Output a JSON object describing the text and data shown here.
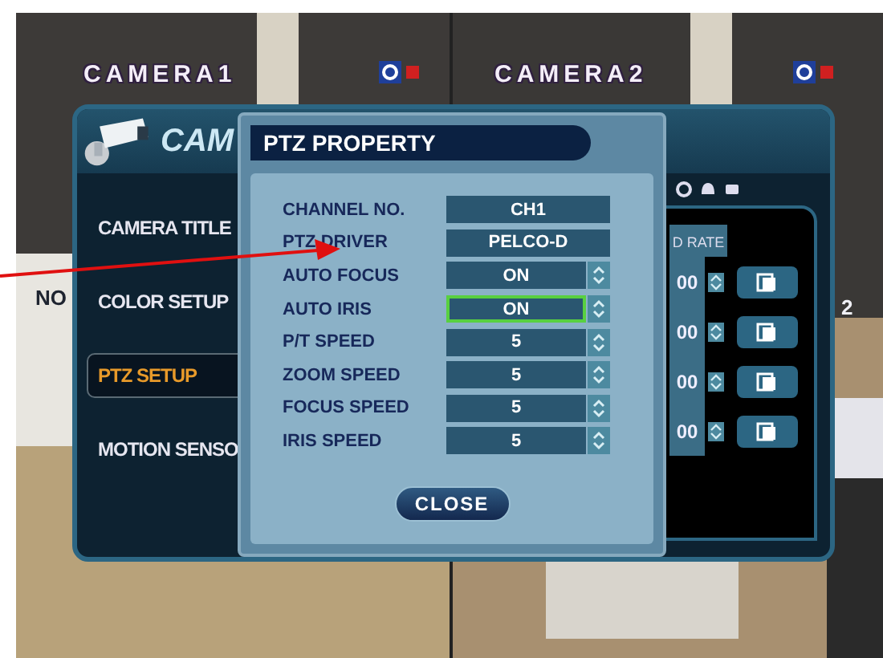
{
  "cameras": [
    {
      "title": "CAMERA1"
    },
    {
      "title": "CAMERA2"
    }
  ],
  "overlay_texts": [
    "NO",
    "2"
  ],
  "setup_window": {
    "title": "CAM",
    "menu": [
      {
        "label": "CAMERA TITLE",
        "selected": false
      },
      {
        "label": "COLOR SETUP",
        "selected": false
      },
      {
        "label": "PTZ SETUP",
        "selected": true
      },
      {
        "label": "MOTION SENSO",
        "selected": false
      }
    ],
    "table": {
      "header": "D RATE",
      "rows": [
        "00",
        "00",
        "00",
        "00"
      ]
    }
  },
  "dialog": {
    "title": "PTZ PROPERTY",
    "rows": [
      {
        "label": "CHANNEL NO.",
        "value": "CH1",
        "kind": "text",
        "focused": false
      },
      {
        "label": "PTZ DRIVER",
        "value": "PELCO-D",
        "kind": "text",
        "focused": false
      },
      {
        "label": "AUTO FOCUS",
        "value": "ON",
        "kind": "spinner",
        "focused": false
      },
      {
        "label": "AUTO IRIS",
        "value": "ON",
        "kind": "spinner",
        "focused": true
      },
      {
        "label": "P/T SPEED",
        "value": "5",
        "kind": "spinner",
        "focused": false
      },
      {
        "label": "ZOOM SPEED",
        "value": "5",
        "kind": "spinner",
        "focused": false
      },
      {
        "label": "FOCUS SPEED",
        "value": "5",
        "kind": "spinner",
        "focused": false
      },
      {
        "label": "IRIS SPEED",
        "value": "5",
        "kind": "spinner",
        "focused": false
      }
    ],
    "close_button": "CLOSE"
  }
}
